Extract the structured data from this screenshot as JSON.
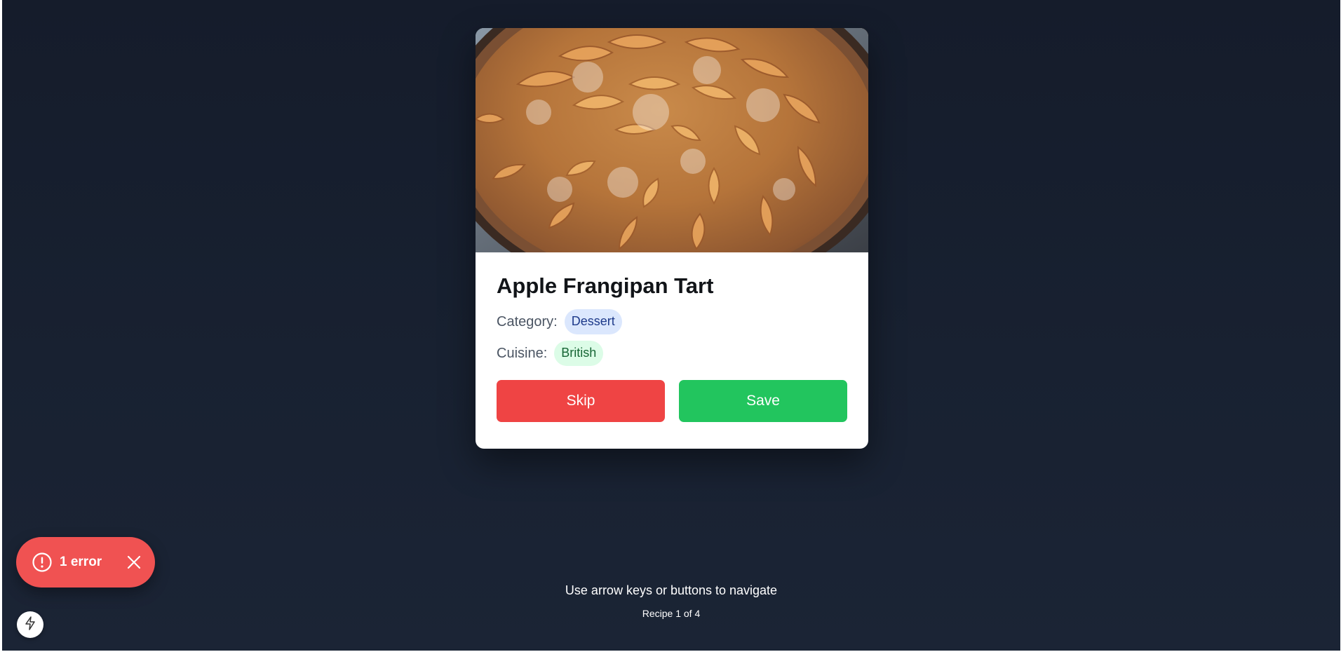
{
  "recipe": {
    "image_alt": "Apple Frangipan Tart",
    "title": "Apple Frangipan Tart",
    "category_label": "Category:",
    "category": "Dessert",
    "cuisine_label": "Cuisine:",
    "cuisine": "British"
  },
  "actions": {
    "skip_label": "Skip",
    "save_label": "Save"
  },
  "footer": {
    "hint": "Use arrow keys or buttons to navigate",
    "counter": "Recipe 1 of 4"
  },
  "dev_overlay": {
    "error_label": "1 error",
    "error_icon": "alert-circle-icon",
    "close_icon": "close-icon",
    "bolt_icon": "lightning-bolt-icon"
  },
  "colors": {
    "background": "#182131",
    "skip": "#ef4444",
    "save": "#22c55e",
    "error_toast": "#f05252",
    "category_tag_bg": "#dbe7fd",
    "cuisine_tag_bg": "#dcfce7"
  }
}
